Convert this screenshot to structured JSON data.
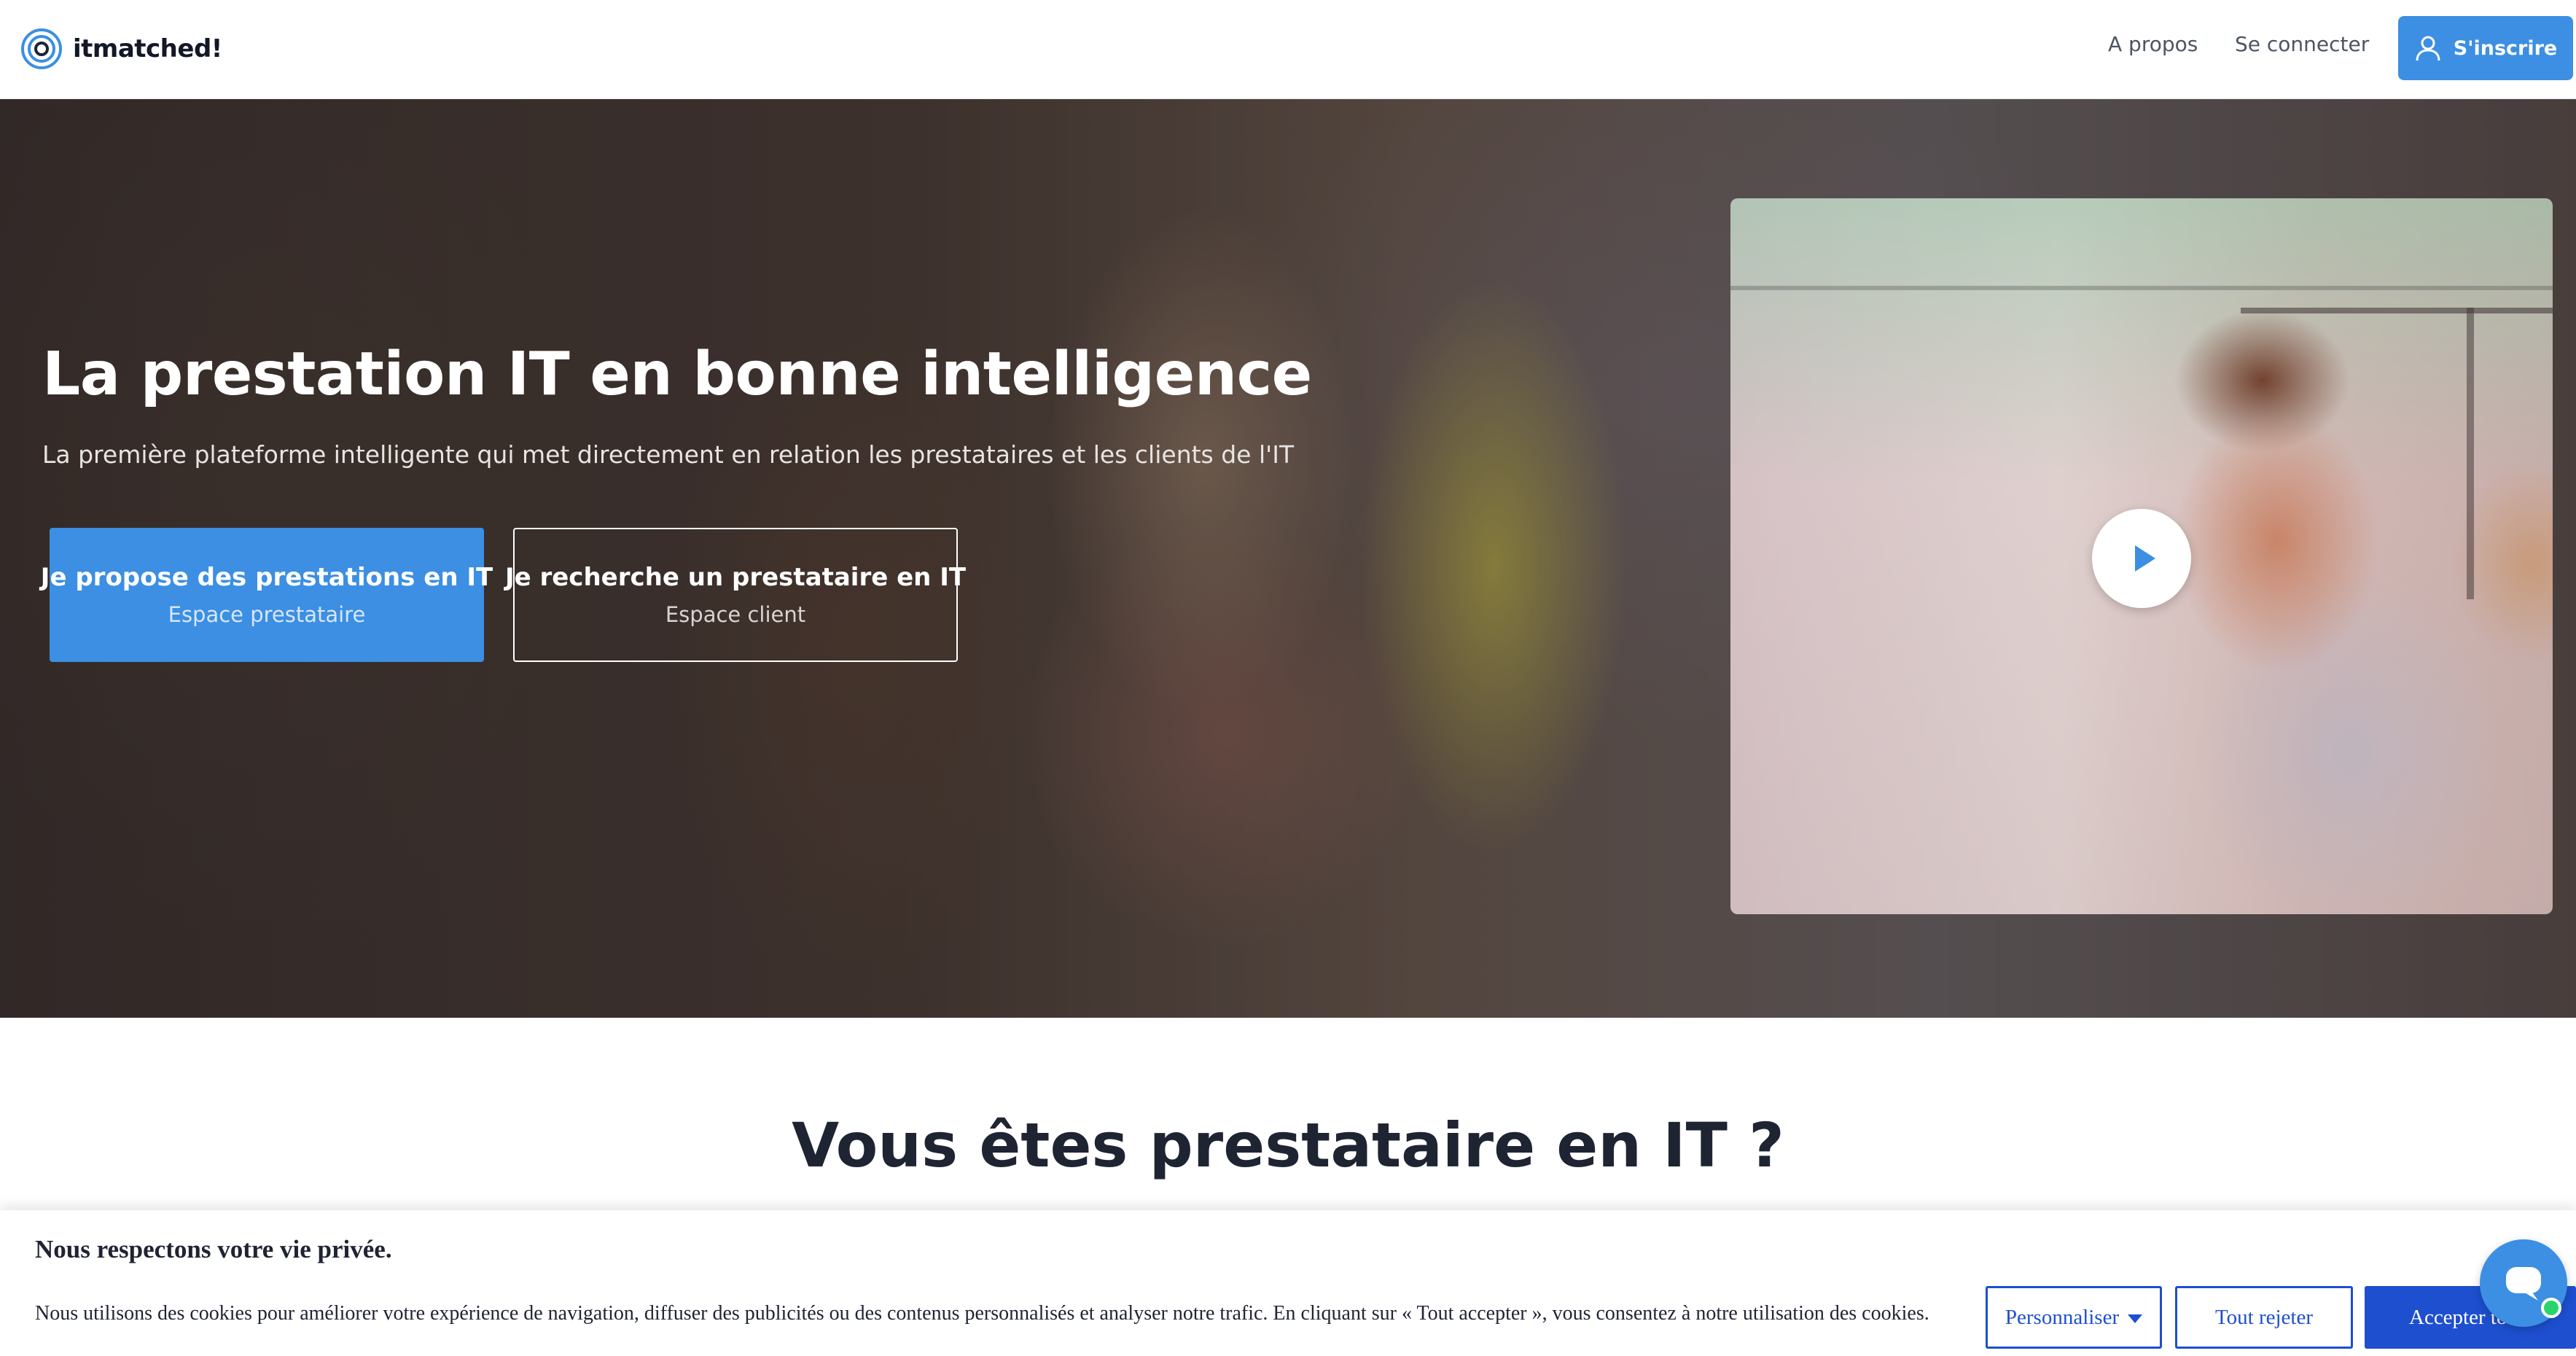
{
  "header": {
    "logo_text": "itmatched!",
    "nav": {
      "about": "A propos",
      "login": "Se connecter"
    },
    "signup_label": "S'inscrire"
  },
  "hero": {
    "title": "La prestation IT en bonne intelligence",
    "subtitle": "La première plateforme intelligente qui met directement en relation les prestataires et les clients de l'IT",
    "cta_provider": {
      "label": "Je propose des prestations en IT",
      "sublabel": "Espace prestataire"
    },
    "cta_client": {
      "label": "Je recherche un prestataire en IT",
      "sublabel": "Espace client"
    }
  },
  "section": {
    "title": "Vous êtes prestataire en IT ?"
  },
  "cookie": {
    "title": "Nous respectons votre vie privée.",
    "text": "Nous utilisons des cookies pour améliorer votre expérience de navigation, diffuser des publicités ou des contenus personnalisés et analyser notre trafic. En cliquant sur « Tout accepter », vous consentez à notre utilisation des cookies.",
    "customize_label": "Personnaliser",
    "reject_label": "Tout rejeter",
    "accept_label": "Accepter tout"
  },
  "colors": {
    "primary": "#3c8fe2",
    "cookie_blue": "#1e4fcf",
    "dark_text": "#1f2433",
    "online_dot": "#2bd46b"
  },
  "icons": [
    "logo-mark-icon",
    "user-icon",
    "play-icon",
    "caret-down-icon",
    "chat-icon"
  ]
}
